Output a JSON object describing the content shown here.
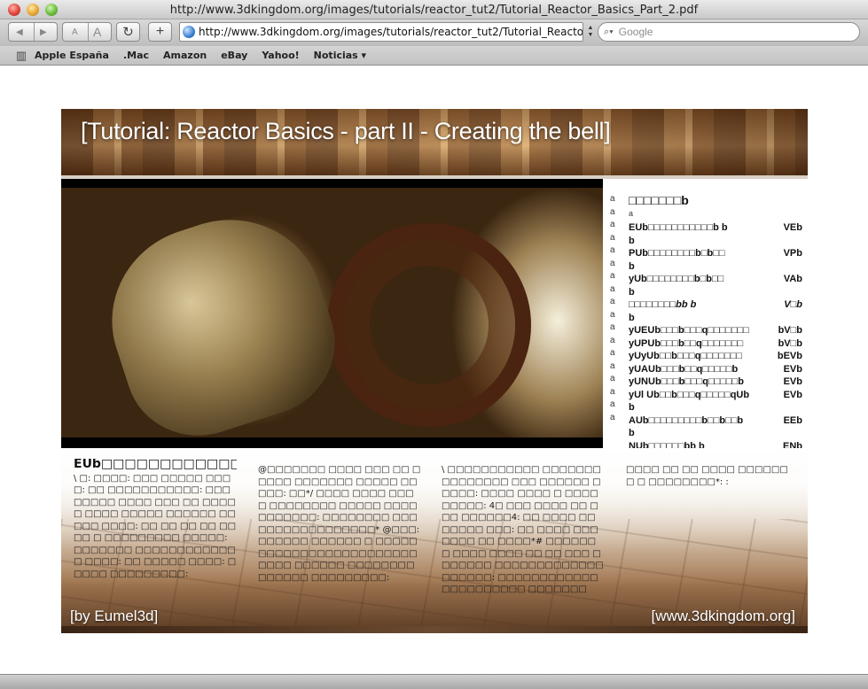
{
  "window": {
    "title": "http://www.3dkingdom.org/images/tutorials/reactor_tut2/Tutorial_Reactor_Basics_Part_2.pdf"
  },
  "toolbar": {
    "back_glyph": "◀",
    "forward_glyph": "▶",
    "text_smaller": "A",
    "text_bigger": "A",
    "reload_glyph": "↻",
    "add_glyph": "+",
    "address": "http://www.3dkingdom.org/images/tutorials/reactor_tut2/Tutorial_Reactor_Basics_Part_2.pdf",
    "search_placeholder": "Google",
    "search_glyph": "⌕▾"
  },
  "bookmarks": {
    "book_glyph": "📖",
    "items": [
      "Apple España",
      ".Mac",
      "Amazon",
      "eBay",
      "Yahoo!",
      "Noticias ▾"
    ]
  },
  "pdf": {
    "banner_title": "[Tutorial: Reactor Basics - part II - Creating the bell]",
    "footer_left": "[by Eumel3d]",
    "footer_right": "[www.3dkingdom.org]",
    "toc": {
      "heading": "□□□□□□□b",
      "markers": "a\na\na\na\na\na\na\na\na\na\na\na\na\na\na\na\na\na",
      "sub": "a",
      "rows": [
        {
          "left": "EUb□□□□□□□□□□□b b",
          "right": "VEb"
        },
        {
          "left": "b",
          "right": ""
        },
        {
          "left": "PUb□□□□□□□□b□b□□",
          "right": "VPb"
        },
        {
          "left": "b",
          "right": ""
        },
        {
          "left": "yUb□□□□□□□□b□b□□",
          "right": "VAb"
        },
        {
          "left": "b",
          "right": ""
        },
        {
          "left": "□□□□□□□□bb   b",
          "right": "V□b"
        },
        {
          "left": "b",
          "right": ""
        },
        {
          "left": "yUEUb□□□b□□□q□□□□□□□",
          "right": "bV□b"
        },
        {
          "left": "yUPUb□□□b□□q□□□□□□□",
          "right": "bV□b"
        },
        {
          "left": "yUyUb□□b□□□q□□□□□□□",
          "right": "bEVb"
        },
        {
          "left": "yUAUb□□□b□□q□□□□□b",
          "right": "EVb"
        },
        {
          "left": "yUNUb□□□b□□□q□□□□□b",
          "right": "EVb"
        },
        {
          "left": "yUl Ub□□b□□□q□□□□□qUb",
          "right": "EVb"
        },
        {
          "left": "b",
          "right": ""
        },
        {
          "left": "AUb□□□□□□□□□b□□b□□b",
          "right": "EEb"
        },
        {
          "left": "b",
          "right": ""
        },
        {
          "left": "NUb□□□□□□bb   b",
          "right": "ENb"
        }
      ]
    },
    "columns": [
      {
        "heading": "EUb□□□□□□□□□□□□b",
        "text": "\\ □: □□□□: □□□ □□□□□ □□□□: □□ □□□□□□□□□□□: □□□ □□□□□ □□□□ □□□ □□ □□□□□ □□□□ □□□□□ □□□□□□ □□□□□ □□□□: □□ □□ □□ □□ □□□□ □ □□□□□□□□□ □□□□□: □□□□□□□ □□□□□□□□□□□□□ □□□□: □□ □□□□□ □□□□: □□□□□ □□□□□□□□□:"
      },
      {
        "heading": "",
        "text": "@□□□□□□□ □□□□ □□□ □□ □□□□□ □□□□□□□ □□□□□ □□□□□: □□*/ □□□□ □□□□ □□□□ □□□□□□□□ □□□□□ □□□□□□□□□□□: □□□□□□□□ □□□□□□□□□□□□□□□□□* @□□□:   □□□□□□   □□□□□□   □ □□□□□□□□□□□□□□□□□□□□□□□□ □□□□ □□□□□□ □□□□□□□□□□□□□□ □□□□□□□□□:"
      },
      {
        "heading": "",
        "text": "\\ □□□□□□□□□□□ □□□□□□□□□□□□□□□ □□□ □□□□□□ □□□□□: □□□□ □□□□ □ □□□□□□□□□: 4□ □□□ □□□□ □□ □□□ □□□□□□4: □□ □□□□ □□ □□□□□ □□□: □□ □□□□ □□□ □□□□ □□ □□□□*# □□□□□□ □ □□□□ □□□□ □□ □□ □□□ □□□□□□□ □□□□□□□□□□□□□□□□□□□: □□□□□□□□□□□□□□□□□□□□□□ □□□□□□□"
      },
      {
        "heading": "",
        "text": "□□□□ □□ □□ □□□□ □□□□□□□ □ □□□□□□□□*: :"
      }
    ]
  }
}
